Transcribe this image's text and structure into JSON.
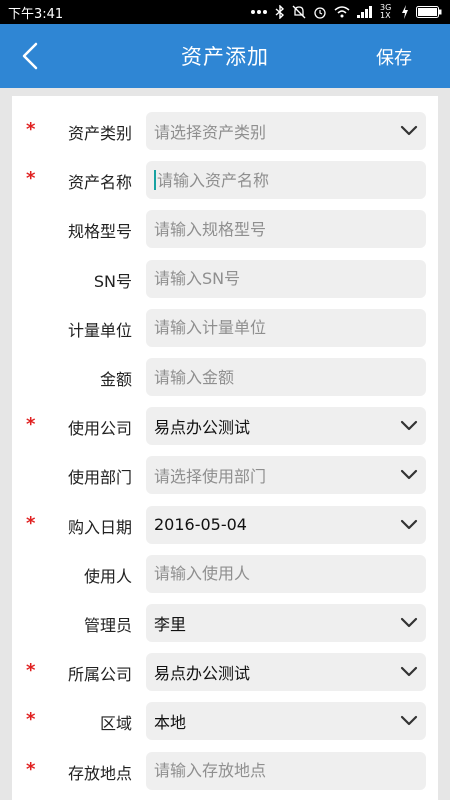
{
  "status_bar": {
    "time": "下午3:41",
    "signal_text": "3G 1X"
  },
  "header": {
    "title": "资产添加",
    "save_label": "保存"
  },
  "fields": [
    {
      "label": "资产类别",
      "required": true,
      "type": "select",
      "value": "",
      "placeholder": "请选择资产类别"
    },
    {
      "label": "资产名称",
      "required": true,
      "type": "input",
      "value": "",
      "placeholder": "请输入资产名称",
      "focused": true
    },
    {
      "label": "规格型号",
      "required": false,
      "type": "input",
      "value": "",
      "placeholder": "请输入规格型号"
    },
    {
      "label": "SN号",
      "required": false,
      "type": "input",
      "value": "",
      "placeholder": "请输入SN号"
    },
    {
      "label": "计量单位",
      "required": false,
      "type": "input",
      "value": "",
      "placeholder": "请输入计量单位"
    },
    {
      "label": "金额",
      "required": false,
      "type": "input",
      "value": "",
      "placeholder": "请输入金额"
    },
    {
      "label": "使用公司",
      "required": true,
      "type": "select",
      "value": "易点办公测试",
      "placeholder": ""
    },
    {
      "label": "使用部门",
      "required": false,
      "type": "select",
      "value": "",
      "placeholder": "请选择使用部门"
    },
    {
      "label": "购入日期",
      "required": true,
      "type": "select",
      "value": "2016-05-04",
      "placeholder": ""
    },
    {
      "label": "使用人",
      "required": false,
      "type": "input",
      "value": "",
      "placeholder": "请输入使用人"
    },
    {
      "label": "管理员",
      "required": false,
      "type": "select",
      "value": "李里",
      "placeholder": ""
    },
    {
      "label": "所属公司",
      "required": true,
      "type": "select",
      "value": "易点办公测试",
      "placeholder": ""
    },
    {
      "label": "区域",
      "required": true,
      "type": "select",
      "value": "本地",
      "placeholder": ""
    },
    {
      "label": "存放地点",
      "required": true,
      "type": "input",
      "value": "",
      "placeholder": "请输入存放地点"
    }
  ],
  "required_mark": "*",
  "colors": {
    "primary": "#2f86d4",
    "required": "#e02020",
    "field_bg": "#efefef",
    "page_bg": "#e6e6e6"
  }
}
